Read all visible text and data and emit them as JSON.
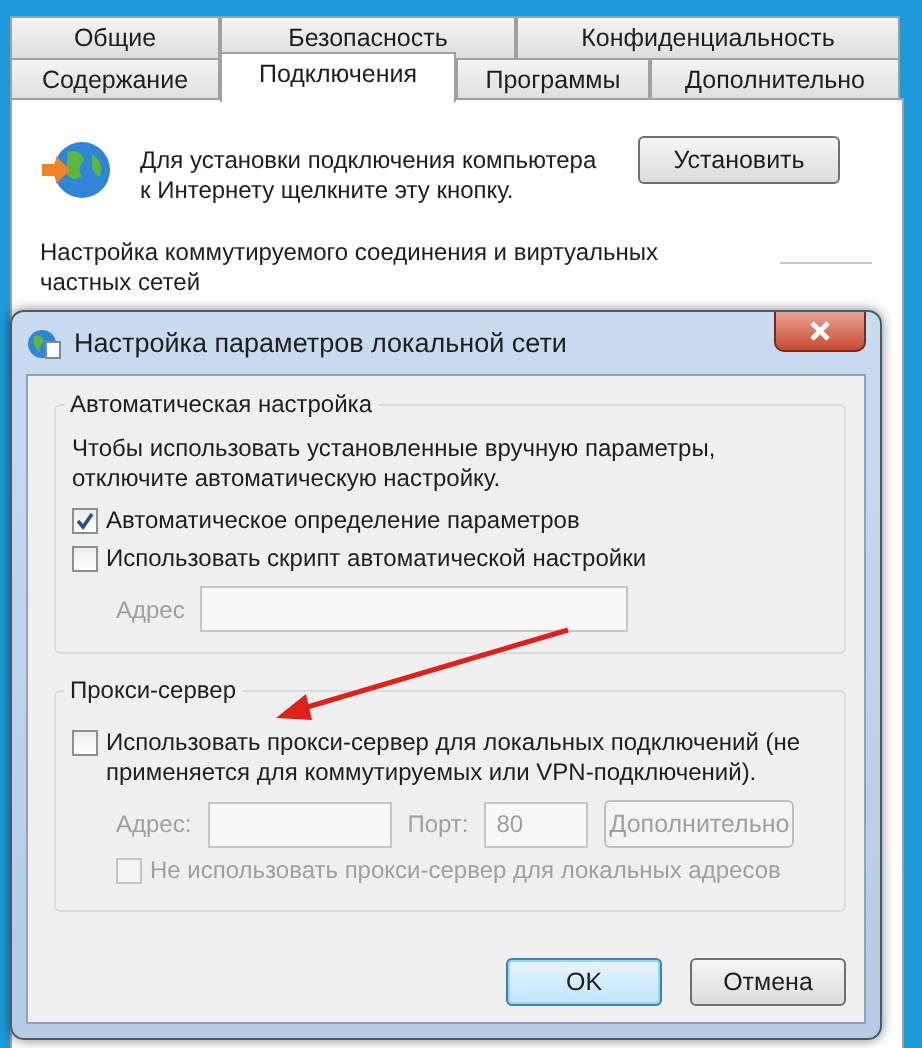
{
  "back_window": {
    "tabs_row_1": [
      {
        "label": "Общие",
        "selected": false
      },
      {
        "label": "Безопасность",
        "selected": false
      },
      {
        "label": "Конфиденциальность",
        "selected": false
      }
    ],
    "tabs_row_2": [
      {
        "label": "Содержание",
        "selected": false
      },
      {
        "label": "Подключения",
        "selected": true
      },
      {
        "label": "Программы",
        "selected": false
      },
      {
        "label": "Дополнительно",
        "selected": false
      }
    ],
    "setup_text": "Для установки подключения компьютера к Интернету щелкните эту кнопку.",
    "setup_button": "Установить",
    "dialup_label": "Настройка коммутируемого соединения и виртуальных частных сетей"
  },
  "dialog": {
    "title": "Настройка параметров локальной сети",
    "auto_config": {
      "title": "Автоматическая настройка",
      "description": "Чтобы использовать установленные вручную параметры, отключите автоматическую настройку.",
      "checkboxes": [
        {
          "label": "Автоматическое определение параметров",
          "checked": true,
          "disabled": false
        },
        {
          "label": "Использовать скрипт автоматической настройки",
          "checked": false,
          "disabled": false
        }
      ],
      "address": {
        "label": "Адрес",
        "disabled": true
      }
    },
    "proxy": {
      "title": "Прокси-сервер",
      "use_proxy": {
        "label": "Использовать прокси-сервер для локальных подключений (не применяется для коммутируемых или VPN-подключений).",
        "checked": false,
        "disabled": false
      },
      "address": {
        "label": "Адрес:",
        "disabled": true
      },
      "port": {
        "label": "Порт:",
        "value": "80",
        "disabled": true
      },
      "advanced_button": {
        "label": "Дополнительно",
        "disabled": true
      },
      "bypass": {
        "label": "Не использовать прокси-сервер для локальных адресов",
        "checked": false,
        "disabled": true
      }
    },
    "buttons": [
      {
        "label": "OK",
        "default": true
      },
      {
        "label": "Отмена",
        "default": false
      }
    ]
  }
}
